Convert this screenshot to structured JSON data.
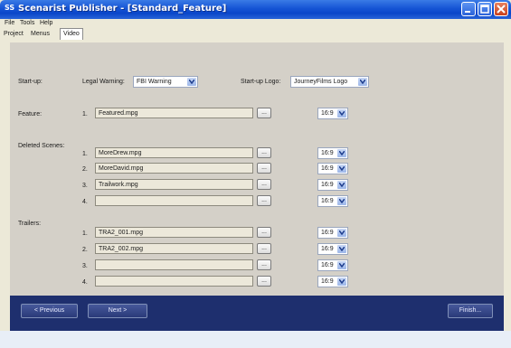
{
  "window": {
    "app_icon": "SS",
    "title": "Scenarist Publisher - [Standard_Feature]"
  },
  "menu": [
    "File",
    "Tools",
    "Help"
  ],
  "tabs": [
    {
      "label": "Project",
      "active": false
    },
    {
      "label": "Menus",
      "active": false
    },
    {
      "label": "Video",
      "active": true
    }
  ],
  "startup": {
    "label": "Start-up:",
    "legal_warning_label": "Legal Warning:",
    "legal_warning_value": "FBI Warning",
    "logo_label": "Start-up Logo:",
    "logo_value": "JourneyFilms Logo"
  },
  "feature": {
    "label": "Feature:",
    "rows": [
      {
        "num": "1.",
        "file": "Featured.mpg",
        "aspect": "16:9"
      }
    ]
  },
  "deleted_scenes": {
    "label": "Deleted Scenes:",
    "rows": [
      {
        "num": "1.",
        "file": "MoreDrew.mpg",
        "aspect": "16:9"
      },
      {
        "num": "2.",
        "file": "MoreDavid.mpg",
        "aspect": "16:9"
      },
      {
        "num": "3.",
        "file": "Trailwork.mpg",
        "aspect": "16:9"
      },
      {
        "num": "4.",
        "file": "",
        "aspect": "16:9"
      }
    ]
  },
  "trailers": {
    "label": "Trailers:",
    "rows": [
      {
        "num": "1.",
        "file": "TRA2_001.mpg",
        "aspect": "16:9"
      },
      {
        "num": "2.",
        "file": "TRA2_002.mpg",
        "aspect": "16:9"
      },
      {
        "num": "3.",
        "file": "",
        "aspect": "16:9"
      },
      {
        "num": "4.",
        "file": "",
        "aspect": "16:9"
      }
    ]
  },
  "browse_label": "...",
  "nav": {
    "previous": "< Previous",
    "next": "Next >",
    "finish": "Finish..."
  },
  "colors": {
    "title_bar": "#1554d4",
    "panel": "#d4d0c8",
    "bottom_bar": "#1e2f6e"
  }
}
